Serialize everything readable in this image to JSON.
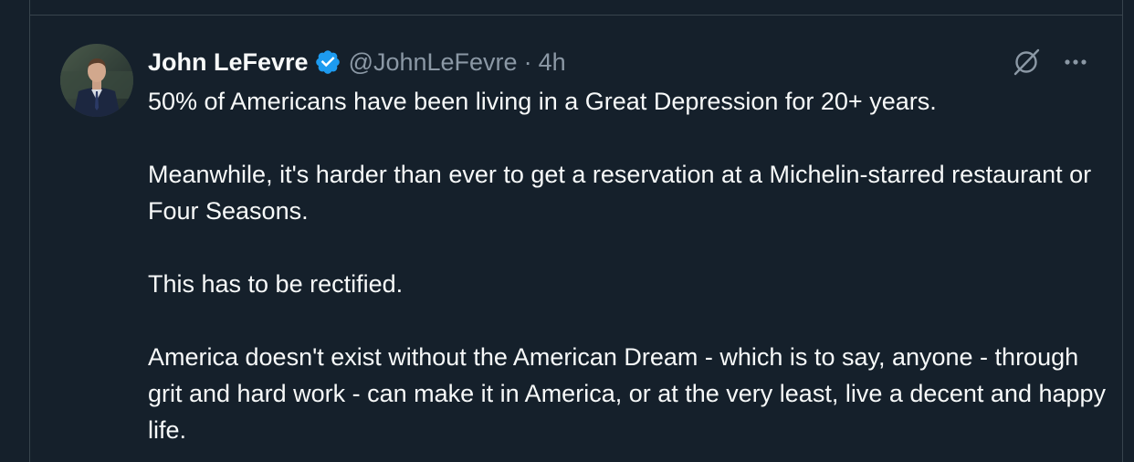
{
  "tweet": {
    "author": {
      "display_name": "John LeFevre",
      "verified": true,
      "handle": "@JohnLeFevre",
      "avatar_icon": "profile-photo-icon"
    },
    "separator": "·",
    "time": "4h",
    "paragraphs": [
      "50% of Americans have been living in a Great Depression for 20+ years.",
      "Meanwhile, it's harder than ever to get a reservation at a Michelin-starred restaurant or Four Seasons.",
      "This has to be rectified.",
      "America doesn't exist without the American Dream - which is to say, anyone - through grit and hard work - can make it in America, or at the very least, live a decent and happy life."
    ]
  },
  "actions": {
    "grok_icon": "grok-icon",
    "more_icon": "more-options-icon"
  },
  "colors": {
    "background": "#15202b",
    "border": "#38444d",
    "text_primary": "#f7f9f9",
    "text_secondary": "#8b98a5",
    "verified_blue": "#1d9bf0"
  }
}
